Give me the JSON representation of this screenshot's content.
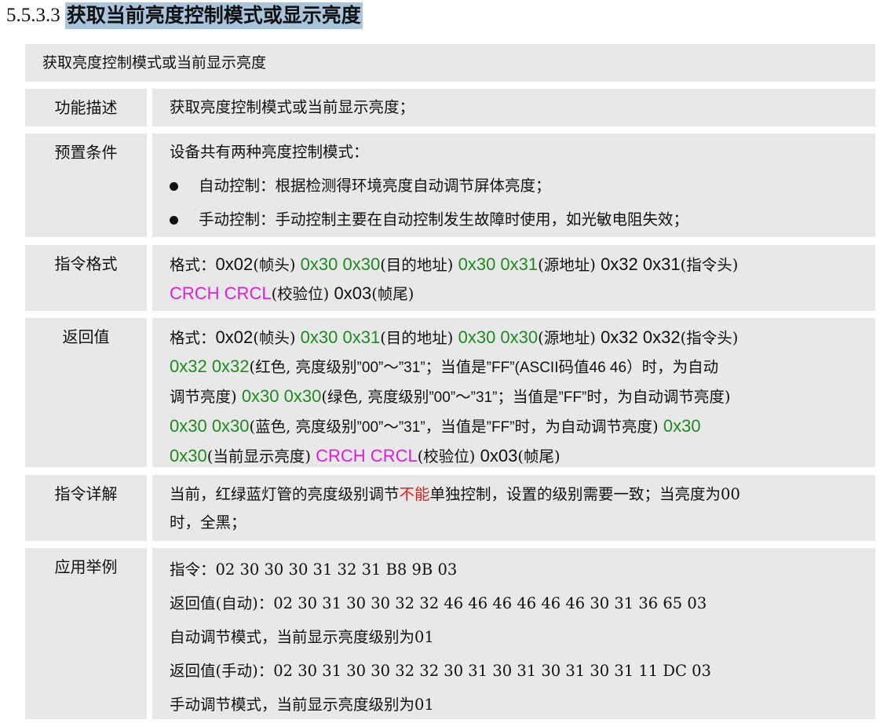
{
  "heading": {
    "number": "5.5.3.3",
    "title": "获取当前亮度控制模式或显示亮度"
  },
  "banner": "获取亮度控制模式或当前显示亮度",
  "rows": {
    "func": {
      "label": "功能描述",
      "text": "获取亮度控制模式或当前显示亮度；"
    },
    "pre": {
      "label": "预置条件",
      "intro": "设备共有两种亮度控制模式：",
      "bullets": [
        "自动控制：根据检测得环境亮度自动调节屏体亮度；",
        "手动控制：手动控制主要在自动控制发生故障时使用，如光敏电阻失效；"
      ]
    },
    "cmd": {
      "label": "指令格式",
      "fmt": "格式：",
      "b0x02": "0x02",
      "frame_head": "(帧头)",
      "dest_code": "0x30 0x30",
      "dest": "(目的地址)",
      "src_code": "0x30 0x31",
      "src": "(源地址)",
      "cmd_code": "0x32 0x31",
      "cmd_head": "(指令头)",
      "crc": "CRCH CRCL",
      "crc_label": "(校验位)",
      "end_code": "0x03",
      "frame_tail": "(帧尾)"
    },
    "ret": {
      "label": "返回值",
      "fmt": "格式：",
      "b0x02": "0x02",
      "frame_head": "(帧头)",
      "dest_code": "0x30 0x31",
      "dest": "(目的地址)",
      "src_code": "0x30 0x30",
      "src": "(源地址)",
      "cmd_code": "0x32 0x32",
      "cmd_head": "(指令头)",
      "red_code": "0x32 0x32",
      "red_a": "(红色, 亮度级别",
      "red_q1": "”00”",
      "red_b": "～",
      "red_q2": "”31”",
      "red_c": "；当值是",
      "red_ff": "”FF”(ASCII",
      "red_d": "码值",
      "red_hex": "46 46",
      "red_e": "）时，为自动",
      "red_f": "调节亮度)",
      "green_code": "0x30 0x30",
      "green_a": "(绿色, 亮度级别",
      "green_q1": "”00”",
      "green_b": "～",
      "green_q2": "”31”",
      "green_c": "；当值是",
      "green_ff": "”FF”",
      "green_d": "时，为自动调节亮度)",
      "blue_code": "0x30 0x30",
      "blue_a": "(蓝色, 亮度级别",
      "blue_q1": "”00”",
      "blue_b": "～",
      "blue_q2": "”31”",
      "blue_c": "，当值是",
      "blue_ff": "”FF”",
      "blue_d": "时，为自动调节亮度)",
      "cur_code1": "0x30",
      "cur_code2": "0x30",
      "cur": "(当前显示亮度)",
      "crc": "CRCH CRCL",
      "crc_label": "(校验位)",
      "end_code": "0x03",
      "frame_tail": "(帧尾)"
    },
    "detail": {
      "label": "指令详解",
      "pre": "当前，红绿蓝灯管的亮度级别调节",
      "red": "不能",
      "post": "单独控制，设置的级别需要一致；当亮度为00",
      "line2": "时，全黑；"
    },
    "example": {
      "label": "应用举例",
      "lines": [
        "指令：02 30 30 30 31 32 31 B8 9B 03",
        "返回值(自动)：02 30 31 30 30 32 32 46 46 46 46 46 46 30 31 36 65 03",
        "自动调节模式，当前显示亮度级别为01",
        "返回值(手动)：02 30 31 30 30 32 32 30 31 30 31 30 31 30 31 11 DC 03",
        "手动调节模式，当前显示亮度级别为01"
      ]
    }
  },
  "colors": {
    "green": "#1f8a1f",
    "magenta": "#e01ee0",
    "red": "#e02020",
    "cell": "#e8e8e8",
    "highlight": "#a9c4dd"
  }
}
